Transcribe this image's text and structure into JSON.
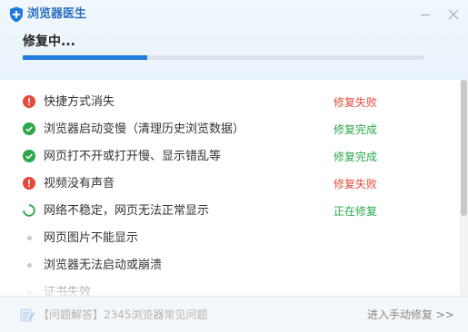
{
  "app": {
    "title": "浏览器医生"
  },
  "status": {
    "title": "修复中...",
    "progress": 0.31
  },
  "colors": {
    "accent": "#1e7be0",
    "fail": "#e54a3a",
    "done": "#2aa84a"
  },
  "items": [
    {
      "label": "快捷方式消失",
      "status": "修复失败",
      "state": "fail",
      "icon": "exclamation-icon"
    },
    {
      "label": "浏览器启动变慢（清理历史浏览数据）",
      "status": "修复完成",
      "state": "done",
      "icon": "check-icon"
    },
    {
      "label": "网页打不开或打开慢、显示错乱等",
      "status": "修复完成",
      "state": "done",
      "icon": "check-icon"
    },
    {
      "label": "视频没有声音",
      "status": "修复失败",
      "state": "fail",
      "icon": "exclamation-icon"
    },
    {
      "label": "网络不稳定，网页无法正常显示",
      "status": "正在修复",
      "state": "progress",
      "icon": "spinner-icon"
    },
    {
      "label": "网页图片不能显示",
      "status": "",
      "state": "pending",
      "icon": "bullet-icon"
    },
    {
      "label": "浏览器无法启动或崩溃",
      "status": "",
      "state": "pending",
      "icon": "bullet-icon"
    },
    {
      "label": "证书失效",
      "status": "",
      "state": "pending",
      "icon": "bullet-icon"
    }
  ],
  "footer": {
    "help_link": "【问题解答】2345浏览器常见问题",
    "manual_link": "进入手动修复 >>"
  }
}
